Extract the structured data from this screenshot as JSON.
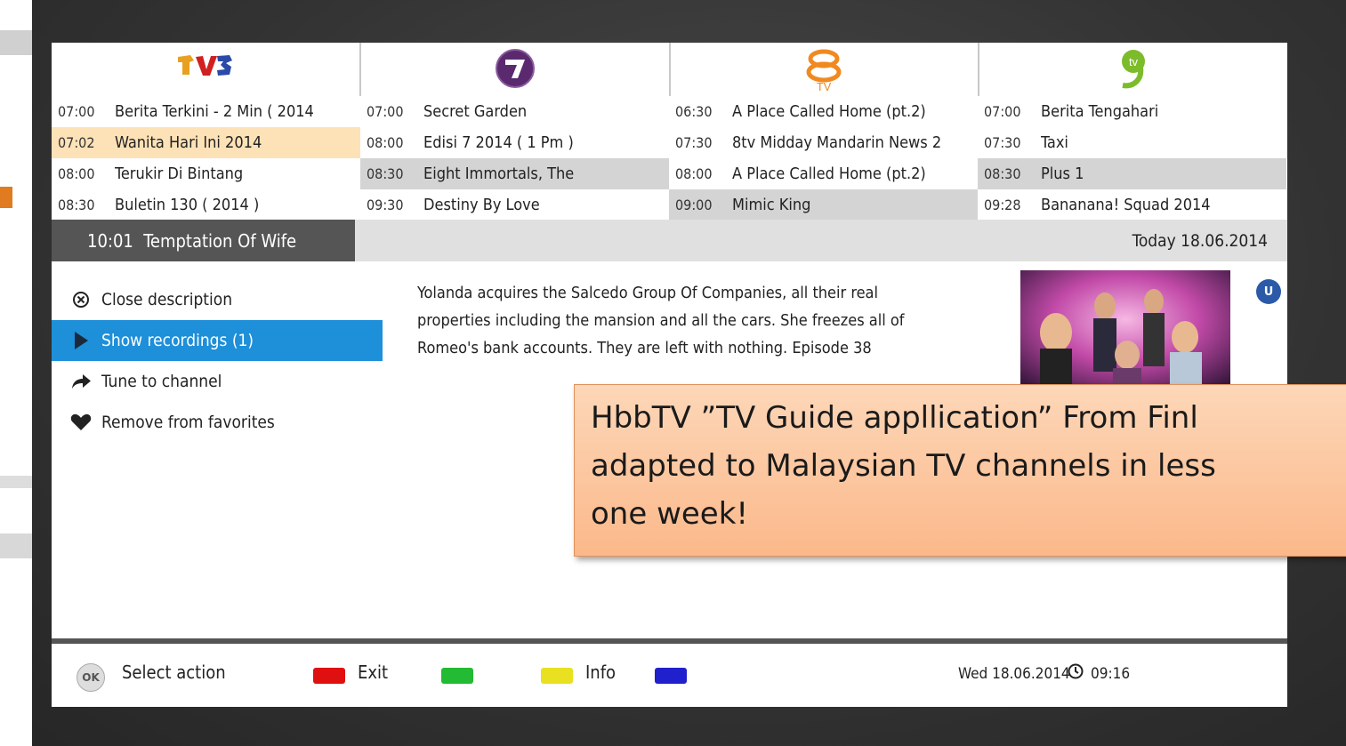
{
  "channels": [
    {
      "name": "TV3",
      "logo_icon": "tv3-logo-icon"
    },
    {
      "name": "NTV7",
      "logo_icon": "ntv7-logo-icon"
    },
    {
      "name": "8TV",
      "logo_icon": "8tv-logo-icon"
    },
    {
      "name": "TV9",
      "logo_icon": "tv9-logo-icon"
    }
  ],
  "schedule": [
    [
      {
        "time": "07:00",
        "title": "Berita Terkini - 2 Min ( 2014"
      },
      {
        "time": "07:02",
        "title": "Wanita Hari Ini 2014",
        "state": "selected"
      },
      {
        "time": "08:00",
        "title": "Terukir Di Bintang"
      },
      {
        "time": "08:30",
        "title": "Buletin 130 ( 2014 )"
      }
    ],
    [
      {
        "time": "07:00",
        "title": "Secret Garden"
      },
      {
        "time": "08:00",
        "title": "Edisi 7 2014 ( 1 Pm )"
      },
      {
        "time": "08:30",
        "title": "Eight Immortals, The",
        "state": "highlight"
      },
      {
        "time": "09:30",
        "title": "Destiny By Love"
      }
    ],
    [
      {
        "time": "06:30",
        "title": "A Place Called Home (pt.2)"
      },
      {
        "time": "07:30",
        "title": "8tv Midday Mandarin News 2"
      },
      {
        "time": "08:00",
        "title": "A Place Called Home (pt.2)"
      },
      {
        "time": "09:00",
        "title": "Mimic King",
        "state": "highlight"
      }
    ],
    [
      {
        "time": "07:00",
        "title": "Berita Tengahari"
      },
      {
        "time": "07:30",
        "title": "Taxi"
      },
      {
        "time": "08:30",
        "title": "Plus 1",
        "state": "highlight"
      },
      {
        "time": "09:28",
        "title": "Bananana! Squad 2014"
      }
    ]
  ],
  "selected_program": {
    "time": "10:01",
    "title": "Temptation Of Wife",
    "date_label": "Today 18.06.2014"
  },
  "actions": [
    {
      "label": "Close description",
      "icon": "close-circle-icon"
    },
    {
      "label": "Show recordings (1)",
      "icon": "play-arrow-icon",
      "active": true
    },
    {
      "label": "Tune to channel",
      "icon": "forward-arrow-icon"
    },
    {
      "label": "Remove from favorites",
      "icon": "heart-icon"
    }
  ],
  "description": "Yolanda acquires the Salcedo Group Of Companies, all their real properties including the mansion and all the cars. She freezes all of Romeo's bank accounts. They are left with nothing. Episode 38",
  "badge": "U",
  "callout": {
    "line1": "HbbTV ”TV Guide appllication” From Finl",
    "line2": "adapted to Malaysian TV channels in less",
    "line3": "one week!"
  },
  "footer": {
    "ok_label": "OK",
    "select_action": "Select action",
    "exit": "Exit",
    "info": "Info",
    "date": "Wed 18.06.2014",
    "time": "09:16",
    "key_colors": {
      "red": "#e01010",
      "green": "#22bb33",
      "yellow": "#e8e020",
      "blue": "#2020cc"
    }
  },
  "colors": {
    "accent": "#1e8fd9",
    "selected_row": "#fde2b7",
    "highlight_row": "#d4d4d4",
    "callout": "#fbc39a"
  }
}
